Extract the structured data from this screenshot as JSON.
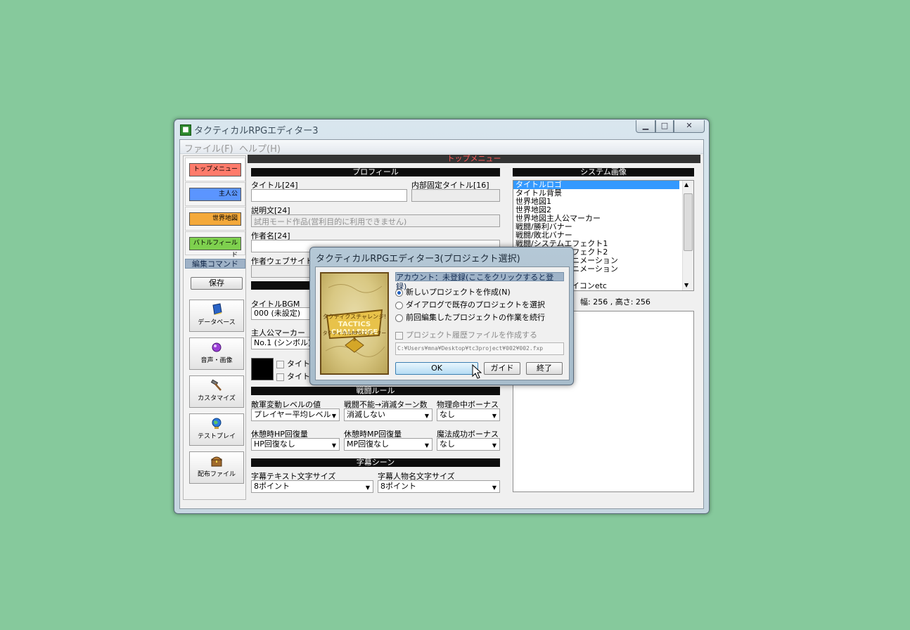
{
  "window": {
    "title": "タクティカルRPGエディター3",
    "min_glyph": "▁",
    "max_glyph": "□",
    "close_glyph": "✕",
    "icon_glyph": "■"
  },
  "menu": {
    "file": "ファイル(F)",
    "help": "ヘルプ(H)"
  },
  "top_menu_header": "トップメニュー",
  "sidebar": {
    "categories": [
      {
        "label": "トップメニュー",
        "color": "#ff7b6b"
      },
      {
        "label": "主人公",
        "color": "#5b95ff"
      },
      {
        "label": "世界地図",
        "color": "#f4a93a"
      },
      {
        "label": "バトルフィールド",
        "color": "#7ed04e"
      }
    ],
    "edit_commands_header": "編集コマンド",
    "save_label": "保存",
    "tools": [
      {
        "label": "データベース",
        "icon": "book-icon"
      },
      {
        "label": "音声・画像",
        "icon": "orb-icon"
      },
      {
        "label": "カスタマイズ",
        "icon": "hammer-icon"
      },
      {
        "label": "テストプレイ",
        "icon": "globe-icon"
      },
      {
        "label": "配布ファイル",
        "icon": "chest-icon"
      }
    ]
  },
  "profile": {
    "header": "プロフィール",
    "title_label": "タイトル[24]",
    "internal_title_label": "内部固定タイトル[16]",
    "description_label": "説明文[24]",
    "description_value": "試用モード作品(営利目的に利用できません)",
    "author_label": "作者名[24]",
    "author_site_label": "作者ウェブサイトU",
    "title_bgm_label": "タイトルBGM",
    "title_bgm_value": "000 (未設定)",
    "hero_marker_label": "主人公マーカー",
    "hero_marker_value": "No.1 (シンボル)",
    "checkbox1_label": "タイトル",
    "checkbox2_label": "タイトル"
  },
  "battle_rules": {
    "header": "戦闘ルール",
    "enemy_level_label": "敵軍変動レベルの値",
    "enemy_level_value": "プレイヤー平均レベル",
    "ko_turns_label": "戦闘不能→消滅ターン数",
    "ko_turns_value": "消滅しない",
    "phys_hit_label": "物理命中ボーナス",
    "phys_hit_value": "なし",
    "rest_hp_label": "休憩時HP回復量",
    "rest_hp_value": "HP回復なし",
    "rest_mp_label": "休憩時MP回復量",
    "rest_mp_value": "MP回復なし",
    "magic_label": "魔法成功ボーナス",
    "magic_value": "なし"
  },
  "subtitle_scene": {
    "header": "字幕シーン",
    "text_size_label": "字幕テキスト文字サイズ",
    "text_size_value": "8ポイント",
    "name_size_label": "字幕人物名文字サイズ",
    "name_size_value": "8ポイント"
  },
  "system_images": {
    "header": "システム画像",
    "items": [
      "タイトルロゴ",
      "タイトル背景",
      "世界地図1",
      "世界地図2",
      "世界地図主人公マーカー",
      "戦闘/勝利バナー",
      "戦闘/敗北バナー",
      "戦闘/システムエフェクト1",
      "戦闘/システムエフェクト2",
      "戦闘/システムアニメーション",
      "戦闘/システムアニメーション",
      "",
      "戦闘/システムアイコンetc"
    ],
    "selected_index": 0,
    "size_text": "幅: 256 , 高さ: 256"
  },
  "dialog": {
    "title": "タクティカルRPGエディター3(プロジェクト選択)",
    "account_link": "アカウント：未登録(ここをクリックすると登録)",
    "options": [
      "新しいプロジェクトを作成(N)",
      "ダイアログで既存のプロジェクトを選択",
      "前回編集したプロジェクトの作業を続行"
    ],
    "selected_option": 0,
    "history_checkbox": "プロジェクト履歴ファイルを作成する",
    "path": "C:¥Users¥mna¥Desktop¥tc3project¥002¥002.fxp",
    "ok": "OK",
    "guide": "ガイド",
    "exit": "終了",
    "banner_line1": "タクティクスチャレンジ!",
    "banner_line2": "TACTICS CHALLENGE",
    "banner_line3": "タクティカルRPGエディター3"
  }
}
